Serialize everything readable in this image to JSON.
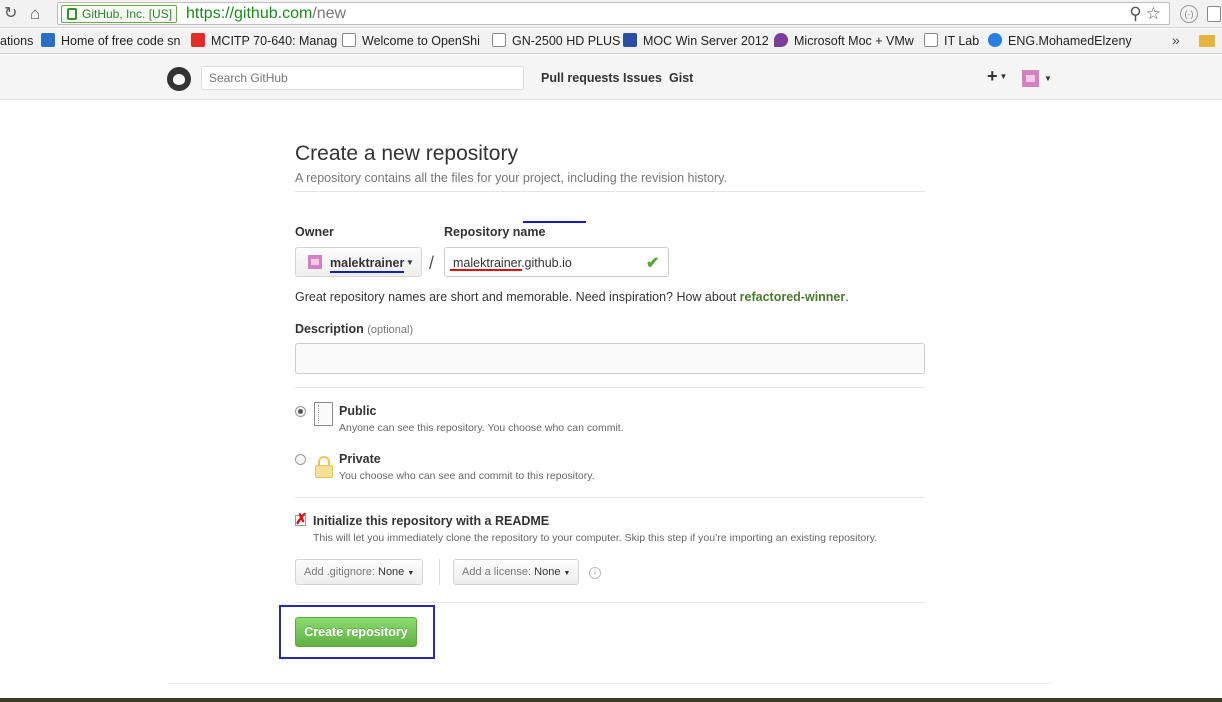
{
  "browser": {
    "ev_label": "GitHub, Inc. [US]",
    "url_scheme_host": "https://github.com",
    "url_path": "/new",
    "bookmarks": [
      {
        "label": "ations",
        "icon": "",
        "color": ""
      },
      {
        "label": "Home of free code sn",
        "icon": "blogger-icon",
        "color": "#2b6ec1"
      },
      {
        "label": "MCITP 70-640: Manag",
        "icon": "youtube-icon",
        "color": "#e52d27"
      },
      {
        "label": "Welcome to OpenShi",
        "icon": "page-icon",
        "color": "#ffffff"
      },
      {
        "label": "GN-2500 HD PLUS",
        "icon": "page-icon",
        "color": "#ffffff"
      },
      {
        "label": "MOC Win Server 2012",
        "icon": "four-icon",
        "color": "#2a4fa0"
      },
      {
        "label": "Microsoft Moc + VMw",
        "icon": "drop-icon",
        "color": "#7a3e9d"
      },
      {
        "label": "IT Lab",
        "icon": "page-icon",
        "color": "#ffffff"
      },
      {
        "label": "ENG.MohamedElzeny",
        "icon": "swirl-icon",
        "color": "#2a7de1"
      }
    ],
    "more_glyph": "»"
  },
  "header": {
    "search_placeholder": "Search GitHub",
    "nav": [
      "Pull requests",
      "Issues",
      "Gist"
    ],
    "plus_glyph": "+"
  },
  "form": {
    "title": "Create a new repository",
    "subtitle": "A repository contains all the files for your project, including the revision history.",
    "owner_label": "Owner",
    "owner_value": "malektrainer",
    "slash": "/",
    "repo_label": "Repository name",
    "repo_value": "malektrainer.github.io",
    "hint_prefix": "Great repository names are short and memorable. Need inspiration? How about ",
    "hint_suggestion": "refactored-winner",
    "hint_suffix": ".",
    "description_label": "Description",
    "description_optional": "(optional)",
    "public_title": "Public",
    "public_desc": "Anyone can see this repository. You choose who can commit.",
    "private_title": "Private",
    "private_desc": "You choose who can see and commit to this repository.",
    "readme_title": "Initialize this repository with a README",
    "readme_desc": "This will let you immediately clone the repository to your computer. Skip this step if you’re importing an existing repository.",
    "gitignore_label": "Add .gitignore:",
    "gitignore_value": "None",
    "license_label": "Add a license:",
    "license_value": "None",
    "info_glyph": "i",
    "create_button": "Create repository"
  },
  "colors": {
    "create_green": "#60b044",
    "annotation_blue": "#1a1ab8",
    "annotation_red": "#e01010"
  }
}
